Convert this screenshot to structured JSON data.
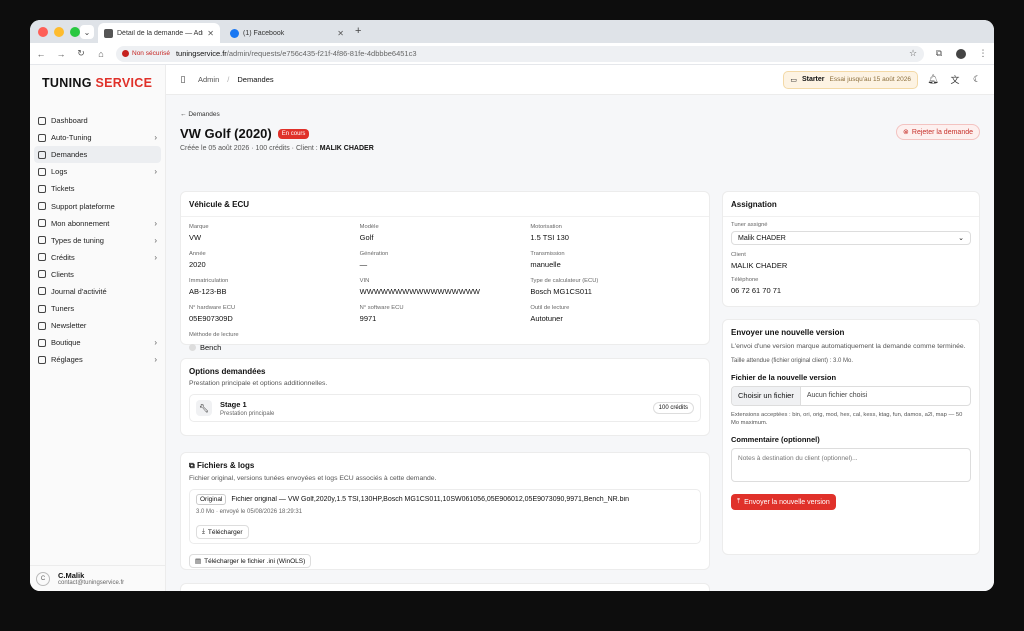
{
  "browser": {
    "tabs": [
      {
        "title": "Détail de la demande — Admi",
        "active": true
      },
      {
        "title": "(1) Facebook",
        "active": false
      }
    ],
    "security_label": "Non sécurisé",
    "url_host": "tuningservice.fr",
    "url_path": "/admin/requests/e756c435-f21f-4f86-81fe-4dbbbe6451c3"
  },
  "sidebar": {
    "brand_a": "TUNING",
    "brand_b": " SERVICE",
    "items": [
      {
        "label": "Dashboard",
        "chevron": false,
        "active": false
      },
      {
        "label": "Auto-Tuning",
        "chevron": true,
        "active": false
      },
      {
        "label": "Demandes",
        "chevron": false,
        "active": true
      },
      {
        "label": "Logs",
        "chevron": true,
        "active": false
      },
      {
        "label": "Tickets",
        "chevron": false,
        "active": false
      },
      {
        "label": "Support plateforme",
        "chevron": false,
        "active": false
      },
      {
        "label": "Mon abonnement",
        "chevron": true,
        "active": false
      },
      {
        "label": "Types de tuning",
        "chevron": true,
        "active": false
      },
      {
        "label": "Crédits",
        "chevron": true,
        "active": false
      },
      {
        "label": "Clients",
        "chevron": false,
        "active": false
      },
      {
        "label": "Journal d'activité",
        "chevron": false,
        "active": false
      },
      {
        "label": "Tuners",
        "chevron": false,
        "active": false
      },
      {
        "label": "Newsletter",
        "chevron": false,
        "active": false
      },
      {
        "label": "Boutique",
        "chevron": true,
        "active": false
      },
      {
        "label": "Réglages",
        "chevron": true,
        "active": false
      }
    ],
    "user": {
      "initial": "C",
      "name": "C.Malik",
      "email": "contact@tuningservice.fr"
    }
  },
  "topbar": {
    "crumb_admin": "Admin",
    "crumb_sep": "/",
    "crumb_current": "Demandes",
    "plan_name": "Starter",
    "plan_sub": "Essai jusqu'au 15 août 2026"
  },
  "header": {
    "back": "Demandes",
    "title": "VW Golf (2020)",
    "status": "En cours",
    "meta_prefix": "Créée le 05 août 2026 · 100 crédits · Client : ",
    "client": "MALIK CHADER",
    "reject": "Rejeter la demande"
  },
  "vehicle": {
    "title": "Véhicule & ECU",
    "fields": [
      {
        "label": "Marque",
        "value": "VW"
      },
      {
        "label": "Modèle",
        "value": "Golf"
      },
      {
        "label": "Motorisation",
        "value": "1.5 TSI 130"
      },
      {
        "label": "Année",
        "value": "2020"
      },
      {
        "label": "Génération",
        "value": "—"
      },
      {
        "label": "Transmission",
        "value": "manuelle"
      },
      {
        "label": "Immatriculation",
        "value": "AB-123-BB"
      },
      {
        "label": "VIN",
        "value": "WWWWWWWWWWWWWWWWW"
      },
      {
        "label": "Type de calculateur (ECU)",
        "value": "Bosch MG1CS011"
      },
      {
        "label": "N° hardware ECU",
        "value": "05E907309D"
      },
      {
        "label": "N° software ECU",
        "value": "9971"
      },
      {
        "label": "Outil de lecture",
        "value": "Autotuner"
      }
    ],
    "method_label": "Méthode de lecture",
    "method_value": "Bench"
  },
  "options": {
    "title": "Options demandées",
    "desc": "Prestation principale et options additionnelles.",
    "item_name": "Stage 1",
    "item_sub": "Prestation principale",
    "item_credits": "100 crédits"
  },
  "files": {
    "title": "Fichiers & logs",
    "desc": "Fichier original, versions tunées envoyées et logs ECU associés à cette demande.",
    "tag": "Original",
    "file_name": "Fichier original — VW Golf,2020y,1.5 TSI,130HP,Bosch MG1CS011,10SW061056,05E906012,05E9073090,9971,Bench_NR.bin",
    "file_meta": "3.0 Mo · envoyé le 05/08/2026 18:29:31",
    "download": "Télécharger",
    "ini_download": "Télécharger le fichier .ini (WinOLS)"
  },
  "assignment": {
    "title": "Assignation",
    "tuner_label": "Tuner assigné",
    "tuner_value": "Malik CHADER",
    "client_label": "Client",
    "client_value": "MALIK CHADER",
    "phone_label": "Téléphone",
    "phone_value": "06 72 61 70 71"
  },
  "upload": {
    "title": "Envoyer une nouvelle version",
    "desc": "L'envoi d'une version marque automatiquement la demande comme terminée.",
    "size_hint": "Taille attendue (fichier original client) : 3.0 Mo.",
    "file_label": "Fichier de la nouvelle version",
    "choose": "Choisir un fichier",
    "no_file": "Aucun fichier choisi",
    "ext_hint": "Extensions acceptées : bin, ori, orig, mod, hex, cal, kess, ktag, fun, damos, a2l, map — 50 Mo maximum.",
    "comment_label": "Commentaire (optionnel)",
    "comment_placeholder": "Notes à destination du client (optionnel)...",
    "submit": "Envoyer la nouvelle version"
  }
}
